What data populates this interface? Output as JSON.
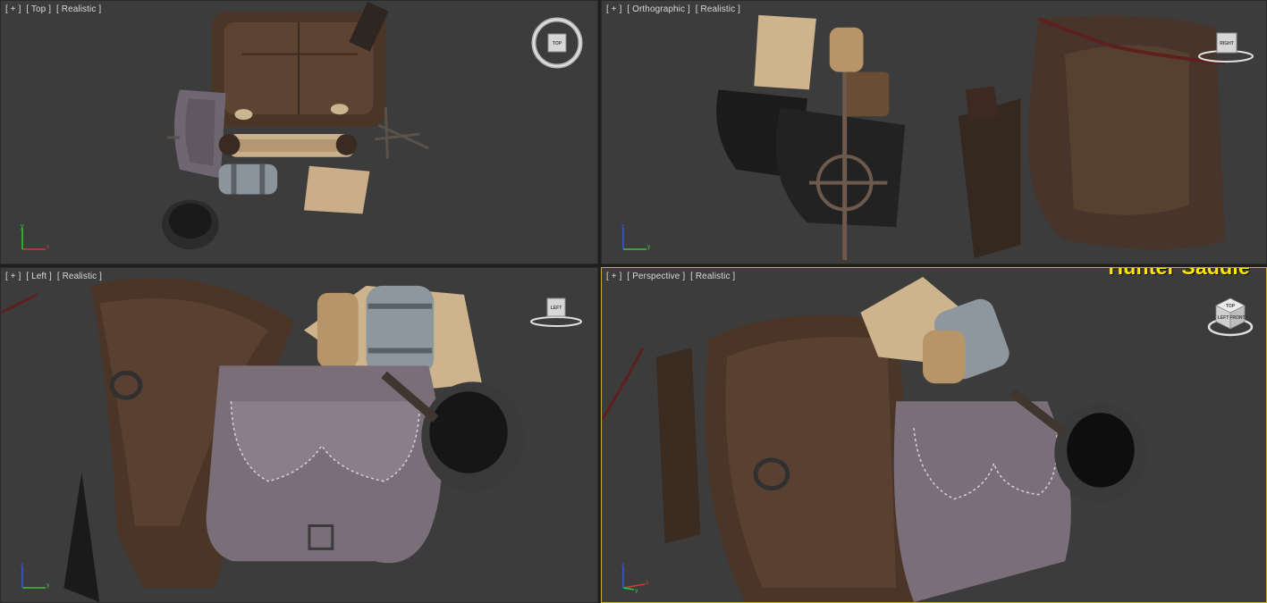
{
  "overlay_title": "Hunter Saddle",
  "viewports": {
    "top": {
      "labels": [
        "[ + ]",
        "[ Top ]",
        "[ Realistic ]"
      ],
      "viewcube_face": "TOP"
    },
    "right": {
      "labels": [
        "[ + ]",
        "[ Orthographic ]",
        "[ Realistic ]"
      ],
      "viewcube_face": "RIGHT"
    },
    "left": {
      "labels": [
        "[ + ]",
        "[ Left ]",
        "[ Realistic ]"
      ],
      "viewcube_face": "LEFT"
    },
    "perspective": {
      "labels": [
        "[ + ]",
        "[ Perspective ]",
        "[ Realistic ]"
      ],
      "viewcube_faces": [
        "TOP",
        "LEFT",
        "FRONT"
      ]
    }
  },
  "axis_labels": {
    "x": "x",
    "y": "y",
    "z": "z"
  },
  "colors": {
    "viewport_bg": "#3c3c3c",
    "active_border": "#c9b035",
    "title_color": "#ffe800",
    "axis_x": "#d23a3a",
    "axis_y": "#3ac23a",
    "axis_z": "#3a5ad2"
  }
}
